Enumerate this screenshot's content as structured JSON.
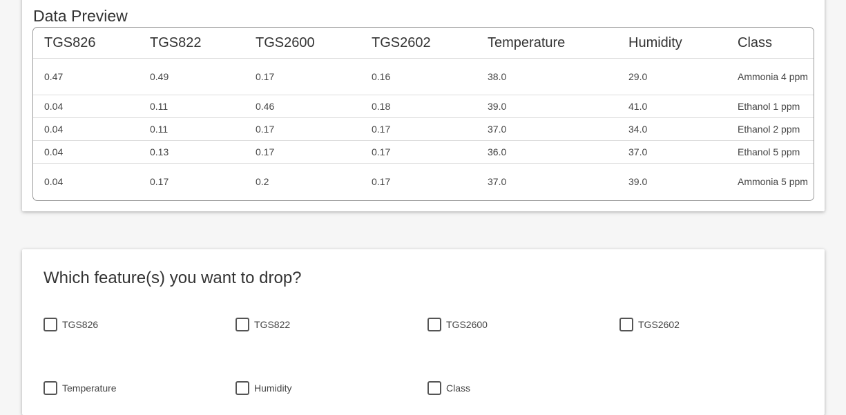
{
  "preview": {
    "title": "Data Preview",
    "columns": [
      "TGS826",
      "TGS822",
      "TGS2600",
      "TGS2602",
      "Temperature",
      "Humidity",
      "Class"
    ],
    "rows": [
      [
        "0.47",
        "0.49",
        "0.17",
        "0.16",
        "38.0",
        "29.0",
        "Ammonia 4 ppm"
      ],
      [
        "0.04",
        "0.11",
        "0.46",
        "0.18",
        "39.0",
        "41.0",
        "Ethanol 1 ppm"
      ],
      [
        "0.04",
        "0.11",
        "0.17",
        "0.17",
        "37.0",
        "34.0",
        "Ethanol 2 ppm"
      ],
      [
        "0.04",
        "0.13",
        "0.17",
        "0.17",
        "36.0",
        "37.0",
        "Ethanol 5 ppm"
      ],
      [
        "0.04",
        "0.17",
        "0.2",
        "0.17",
        "37.0",
        "39.0",
        "Ammonia 5 ppm"
      ]
    ]
  },
  "drop": {
    "title": "Which feature(s) you want to drop?",
    "options": [
      {
        "label": "TGS826",
        "checked": false
      },
      {
        "label": "TGS822",
        "checked": false
      },
      {
        "label": "TGS2600",
        "checked": false
      },
      {
        "label": "TGS2602",
        "checked": false
      },
      {
        "label": "Temperature",
        "checked": false
      },
      {
        "label": "Humidity",
        "checked": false
      },
      {
        "label": "Class",
        "checked": false
      }
    ]
  }
}
